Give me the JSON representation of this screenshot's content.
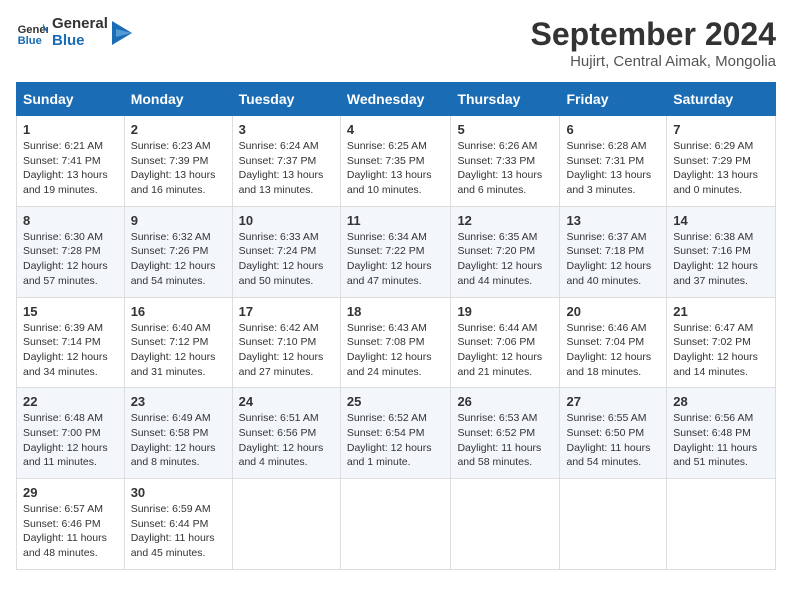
{
  "header": {
    "logo_general": "General",
    "logo_blue": "Blue",
    "month_title": "September 2024",
    "subtitle": "Hujirt, Central Aimak, Mongolia"
  },
  "days_of_week": [
    "Sunday",
    "Monday",
    "Tuesday",
    "Wednesday",
    "Thursday",
    "Friday",
    "Saturday"
  ],
  "weeks": [
    [
      {
        "day": "1",
        "sunrise": "6:21 AM",
        "sunset": "7:41 PM",
        "daylight": "13 hours and 19 minutes."
      },
      {
        "day": "2",
        "sunrise": "6:23 AM",
        "sunset": "7:39 PM",
        "daylight": "13 hours and 16 minutes."
      },
      {
        "day": "3",
        "sunrise": "6:24 AM",
        "sunset": "7:37 PM",
        "daylight": "13 hours and 13 minutes."
      },
      {
        "day": "4",
        "sunrise": "6:25 AM",
        "sunset": "7:35 PM",
        "daylight": "13 hours and 10 minutes."
      },
      {
        "day": "5",
        "sunrise": "6:26 AM",
        "sunset": "7:33 PM",
        "daylight": "13 hours and 6 minutes."
      },
      {
        "day": "6",
        "sunrise": "6:28 AM",
        "sunset": "7:31 PM",
        "daylight": "13 hours and 3 minutes."
      },
      {
        "day": "7",
        "sunrise": "6:29 AM",
        "sunset": "7:29 PM",
        "daylight": "13 hours and 0 minutes."
      }
    ],
    [
      {
        "day": "8",
        "sunrise": "6:30 AM",
        "sunset": "7:28 PM",
        "daylight": "12 hours and 57 minutes."
      },
      {
        "day": "9",
        "sunrise": "6:32 AM",
        "sunset": "7:26 PM",
        "daylight": "12 hours and 54 minutes."
      },
      {
        "day": "10",
        "sunrise": "6:33 AM",
        "sunset": "7:24 PM",
        "daylight": "12 hours and 50 minutes."
      },
      {
        "day": "11",
        "sunrise": "6:34 AM",
        "sunset": "7:22 PM",
        "daylight": "12 hours and 47 minutes."
      },
      {
        "day": "12",
        "sunrise": "6:35 AM",
        "sunset": "7:20 PM",
        "daylight": "12 hours and 44 minutes."
      },
      {
        "day": "13",
        "sunrise": "6:37 AM",
        "sunset": "7:18 PM",
        "daylight": "12 hours and 40 minutes."
      },
      {
        "day": "14",
        "sunrise": "6:38 AM",
        "sunset": "7:16 PM",
        "daylight": "12 hours and 37 minutes."
      }
    ],
    [
      {
        "day": "15",
        "sunrise": "6:39 AM",
        "sunset": "7:14 PM",
        "daylight": "12 hours and 34 minutes."
      },
      {
        "day": "16",
        "sunrise": "6:40 AM",
        "sunset": "7:12 PM",
        "daylight": "12 hours and 31 minutes."
      },
      {
        "day": "17",
        "sunrise": "6:42 AM",
        "sunset": "7:10 PM",
        "daylight": "12 hours and 27 minutes."
      },
      {
        "day": "18",
        "sunrise": "6:43 AM",
        "sunset": "7:08 PM",
        "daylight": "12 hours and 24 minutes."
      },
      {
        "day": "19",
        "sunrise": "6:44 AM",
        "sunset": "7:06 PM",
        "daylight": "12 hours and 21 minutes."
      },
      {
        "day": "20",
        "sunrise": "6:46 AM",
        "sunset": "7:04 PM",
        "daylight": "12 hours and 18 minutes."
      },
      {
        "day": "21",
        "sunrise": "6:47 AM",
        "sunset": "7:02 PM",
        "daylight": "12 hours and 14 minutes."
      }
    ],
    [
      {
        "day": "22",
        "sunrise": "6:48 AM",
        "sunset": "7:00 PM",
        "daylight": "12 hours and 11 minutes."
      },
      {
        "day": "23",
        "sunrise": "6:49 AM",
        "sunset": "6:58 PM",
        "daylight": "12 hours and 8 minutes."
      },
      {
        "day": "24",
        "sunrise": "6:51 AM",
        "sunset": "6:56 PM",
        "daylight": "12 hours and 4 minutes."
      },
      {
        "day": "25",
        "sunrise": "6:52 AM",
        "sunset": "6:54 PM",
        "daylight": "12 hours and 1 minute."
      },
      {
        "day": "26",
        "sunrise": "6:53 AM",
        "sunset": "6:52 PM",
        "daylight": "11 hours and 58 minutes."
      },
      {
        "day": "27",
        "sunrise": "6:55 AM",
        "sunset": "6:50 PM",
        "daylight": "11 hours and 54 minutes."
      },
      {
        "day": "28",
        "sunrise": "6:56 AM",
        "sunset": "6:48 PM",
        "daylight": "11 hours and 51 minutes."
      }
    ],
    [
      {
        "day": "29",
        "sunrise": "6:57 AM",
        "sunset": "6:46 PM",
        "daylight": "11 hours and 48 minutes."
      },
      {
        "day": "30",
        "sunrise": "6:59 AM",
        "sunset": "6:44 PM",
        "daylight": "11 hours and 45 minutes."
      },
      null,
      null,
      null,
      null,
      null
    ]
  ]
}
